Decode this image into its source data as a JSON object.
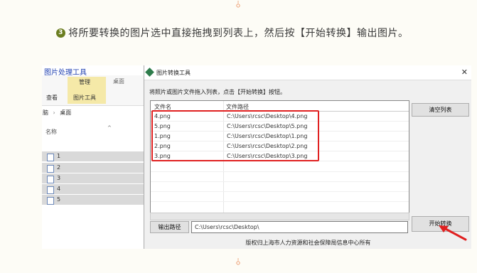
{
  "step": {
    "number": "3",
    "text": "将所要转换的图片选中直接拖拽到列表上，然后按【开始转换】输出图片。"
  },
  "explorer": {
    "title": "图片处理工具",
    "ribbon_manage": "管理",
    "ribbon_desktop": "桌面",
    "ribbon_view": "查看",
    "ribbon_picture_tools": "图片工具",
    "path_root": "脑",
    "path_sep": "›",
    "path_folder": "桌面",
    "column_name": "名称",
    "sort_caret": "^",
    "files": [
      "1",
      "2",
      "3",
      "4",
      "5"
    ]
  },
  "dialog": {
    "title": "图片转换工具",
    "close": "✕",
    "instruction": "将照片或图片文件拖入列表，点击【开始转换】按钮。",
    "col_filename": "文件名",
    "col_filepath": "文件路径",
    "rows": [
      {
        "name": "4.png",
        "path": "C:\\Users\\rcsc\\Desktop\\4.png"
      },
      {
        "name": "5.png",
        "path": "C:\\Users\\rcsc\\Desktop\\5.png"
      },
      {
        "name": "1.png",
        "path": "C:\\Users\\rcsc\\Desktop\\1.png"
      },
      {
        "name": "2.png",
        "path": "C:\\Users\\rcsc\\Desktop\\2.png"
      },
      {
        "name": "3.png",
        "path": "C:\\Users\\rcsc\\Desktop\\3.png"
      }
    ],
    "clear_button": "清空列表",
    "output_button": "输出路径",
    "output_path": "C:\\Users\\rcsc\\Desktop\\",
    "start_button": "开始转换",
    "copyright": "版权归上海市人力资源和社会保障局信息中心所有"
  },
  "colors": {
    "accent_green": "#6b7d1f",
    "ornament": "#e8804a",
    "highlight": "#e02020"
  }
}
